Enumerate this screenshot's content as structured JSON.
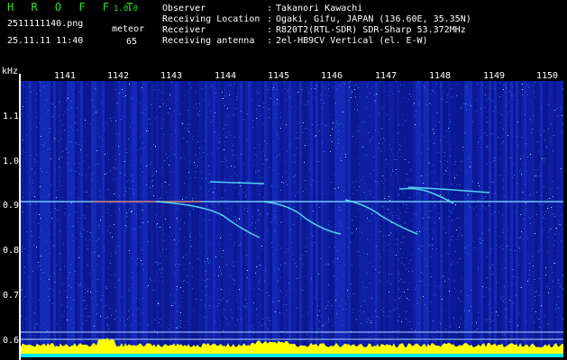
{
  "header": {
    "app_title": "H R O F F T",
    "app_version": "1.0.0",
    "file_name": "2511111140.png",
    "timestamp": "25.11.11 11:40",
    "meteor_label": "meteor",
    "meteor_count": "65"
  },
  "metadata": [
    {
      "key": "Observer",
      "value": "Takanori Kawachi"
    },
    {
      "key": "Receiving Location",
      "value": "Ogaki, Gifu, JAPAN (136.60E, 35.35N)"
    },
    {
      "key": "Receiver",
      "value": "R820T2(RTL-SDR) SDR-Sharp 53.372MHz"
    },
    {
      "key": "Receiving antenna",
      "value": "2el-HB9CV Vertical (el. E-W)"
    }
  ],
  "colon": ":",
  "axis": {
    "unit": "kHz",
    "y_ticks": [
      "1.1",
      "1.0",
      "0.9",
      "0.8",
      "0.7",
      "0.6"
    ],
    "x_ticks": [
      "1141",
      "1142",
      "1143",
      "1144",
      "1145",
      "1146",
      "1147",
      "1148",
      "1149",
      "1150"
    ]
  },
  "colors": {
    "background": "#000000",
    "title_green": "#2fe02f",
    "spectrum_blue": "#0a1a9a",
    "signal_cyan": "#40e0ff",
    "power_yellow": "#ffff00",
    "noise_cyan": "#00ffff"
  }
}
